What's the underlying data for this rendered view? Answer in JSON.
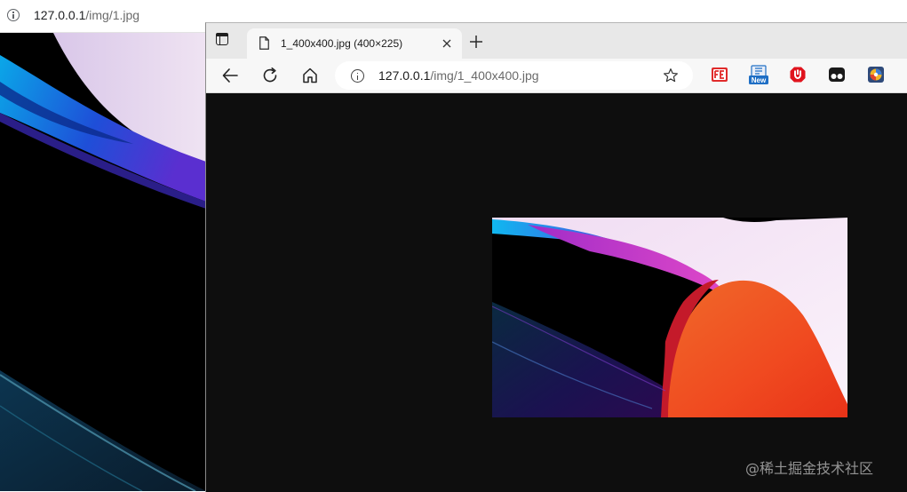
{
  "background_window": {
    "url_host": "127.0.0.1",
    "url_path": "/img/1.jpg",
    "icons": {
      "site_info": "info-icon"
    }
  },
  "browser": {
    "tab": {
      "title": "1_400x400.jpg (400×225)",
      "icon": "page-icon",
      "close_icon": "close-icon"
    },
    "new_tab_icon": "plus-icon",
    "toolbar": {
      "back_icon": "arrow-left-icon",
      "reload_icon": "refresh-icon",
      "home_icon": "home-icon",
      "url_host": "127.0.0.1",
      "url_path": "/img/1_400x400.jpg",
      "favorite_icon": "star-icon"
    },
    "extensions": [
      {
        "name": "fe-extension-icon",
        "label": "FE",
        "color": "#e02b2b"
      },
      {
        "name": "new-extension-icon",
        "label": "New",
        "color": "#1f6fc5"
      },
      {
        "name": "red-shield-extension-icon",
        "label": "",
        "color": "#e0141e"
      },
      {
        "name": "tampermonkey-extension-icon",
        "label": "",
        "color": "#1a1a1a"
      },
      {
        "name": "colorful-extension-icon",
        "label": "",
        "color": "#3a7bd5"
      }
    ]
  },
  "colors": {
    "viewer_background": "#0e0e0e",
    "tab_strip": "#e8e8e8",
    "toolbar": "#f7f7f7"
  },
  "watermark": "@稀土掘金技术社区"
}
